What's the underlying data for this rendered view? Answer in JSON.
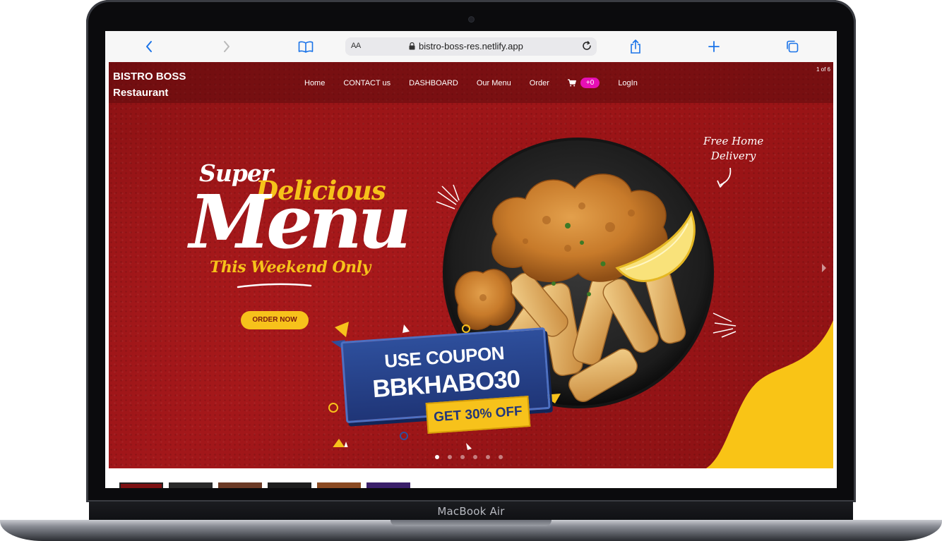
{
  "device": {
    "label": "MacBook Air"
  },
  "browser": {
    "url": "bistro-boss-res.netlify.app",
    "text_size": "AA"
  },
  "site": {
    "brand_line1": "BISTRO BOSS",
    "brand_line2": "Restaurant",
    "nav": {
      "home": "Home",
      "contact": "CONTACT us",
      "dashboard": "DASHBOARD",
      "menu": "Our Menu",
      "order": "Order",
      "cart_count": "+0",
      "login": "LogIn"
    },
    "slide_counter": "1 of 6"
  },
  "hero": {
    "super": "Super",
    "delicious": "Delicious",
    "menu": "Menu",
    "weekend": "This Weekend Only",
    "cta": "ORDER NOW",
    "free_delivery_line1": "Free Home",
    "free_delivery_line2": "Delivery",
    "coupon_line1": "USE COUPON",
    "coupon_code": "BBKHABO30",
    "coupon_offer": "GET 30% OFF"
  },
  "carousel": {
    "slide_count": 6,
    "active_index": 0,
    "thumbnail_count": 6
  },
  "colors": {
    "hero_red": "#9a1416",
    "accent_yellow": "#f7c21b",
    "coupon_blue": "#1f3577",
    "badge_pink": "#e60fb5"
  }
}
